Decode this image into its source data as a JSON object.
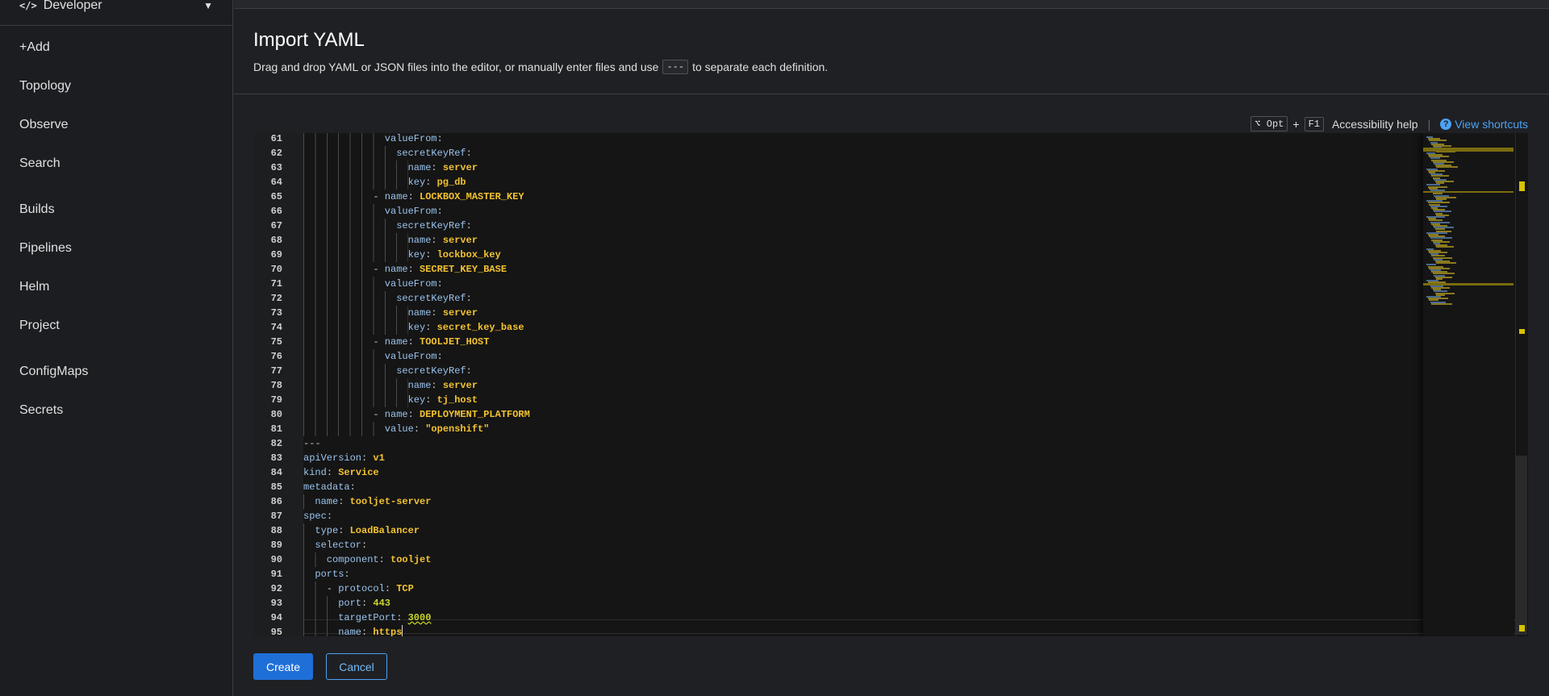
{
  "sidebar": {
    "perspective": "Developer",
    "items": [
      "+Add",
      "Topology",
      "Observe",
      "Search",
      "Builds",
      "Pipelines",
      "Helm",
      "Project",
      "ConfigMaps",
      "Secrets"
    ]
  },
  "header": {
    "title": "Import YAML",
    "desc_before": "Drag and drop YAML or JSON files into the editor, or manually enter files and use",
    "separator": "---",
    "desc_after": "to separate each definition."
  },
  "toolbar": {
    "key1": "⌥ Opt",
    "plus": "+",
    "key2": "F1",
    "accessibility": "Accessibility help",
    "divider": "|",
    "shortcuts": "View shortcuts"
  },
  "editor": {
    "lines": [
      {
        "n": 61,
        "i": 14,
        "k": "valueFrom"
      },
      {
        "n": 62,
        "i": 16,
        "k": "secretKeyRef"
      },
      {
        "n": 63,
        "i": 18,
        "k": "name",
        "v": "server",
        "t": "s"
      },
      {
        "n": 64,
        "i": 18,
        "k": "key",
        "v": "pg_db",
        "t": "s"
      },
      {
        "n": 65,
        "i": 12,
        "dash": true,
        "k": "name",
        "v": "LOCKBOX_MASTER_KEY",
        "t": "s"
      },
      {
        "n": 66,
        "i": 14,
        "k": "valueFrom"
      },
      {
        "n": 67,
        "i": 16,
        "k": "secretKeyRef"
      },
      {
        "n": 68,
        "i": 18,
        "k": "name",
        "v": "server",
        "t": "s"
      },
      {
        "n": 69,
        "i": 18,
        "k": "key",
        "v": "lockbox_key",
        "t": "s"
      },
      {
        "n": 70,
        "i": 12,
        "dash": true,
        "k": "name",
        "v": "SECRET_KEY_BASE",
        "t": "s"
      },
      {
        "n": 71,
        "i": 14,
        "k": "valueFrom"
      },
      {
        "n": 72,
        "i": 16,
        "k": "secretKeyRef"
      },
      {
        "n": 73,
        "i": 18,
        "k": "name",
        "v": "server",
        "t": "s"
      },
      {
        "n": 74,
        "i": 18,
        "k": "key",
        "v": "secret_key_base",
        "t": "s"
      },
      {
        "n": 75,
        "i": 12,
        "dash": true,
        "k": "name",
        "v": "TOOLJET_HOST",
        "t": "s"
      },
      {
        "n": 76,
        "i": 14,
        "k": "valueFrom"
      },
      {
        "n": 77,
        "i": 16,
        "k": "secretKeyRef"
      },
      {
        "n": 78,
        "i": 18,
        "k": "name",
        "v": "server",
        "t": "s"
      },
      {
        "n": 79,
        "i": 18,
        "k": "key",
        "v": "tj_host",
        "t": "s"
      },
      {
        "n": 80,
        "i": 12,
        "dash": true,
        "k": "name",
        "v": "DEPLOYMENT_PLATFORM",
        "t": "s"
      },
      {
        "n": 81,
        "i": 14,
        "k": "value",
        "v": "\"openshift\"",
        "t": "s"
      },
      {
        "n": 82,
        "i": 0,
        "raw": "---"
      },
      {
        "n": 83,
        "i": 0,
        "k": "apiVersion",
        "v": "v1",
        "t": "s"
      },
      {
        "n": 84,
        "i": 0,
        "k": "kind",
        "v": "Service",
        "t": "s"
      },
      {
        "n": 85,
        "i": 0,
        "k": "metadata"
      },
      {
        "n": 86,
        "i": 2,
        "k": "name",
        "v": "tooljet-server",
        "t": "s"
      },
      {
        "n": 87,
        "i": 0,
        "k": "spec"
      },
      {
        "n": 88,
        "i": 2,
        "k": "type",
        "v": "LoadBalancer",
        "t": "s"
      },
      {
        "n": 89,
        "i": 2,
        "k": "selector"
      },
      {
        "n": 90,
        "i": 4,
        "k": "component",
        "v": "tooljet",
        "t": "s"
      },
      {
        "n": 91,
        "i": 2,
        "k": "ports"
      },
      {
        "n": 92,
        "i": 4,
        "dash": true,
        "k": "protocol",
        "v": "TCP",
        "t": "s"
      },
      {
        "n": 93,
        "i": 6,
        "k": "port",
        "v": "443",
        "t": "n"
      },
      {
        "n": 94,
        "i": 6,
        "k": "targetPort",
        "v": "3000",
        "t": "n"
      },
      {
        "n": 95,
        "i": 6,
        "k": "name",
        "v": "https",
        "t": "s"
      }
    ]
  },
  "actions": {
    "create": "Create",
    "cancel": "Cancel"
  }
}
